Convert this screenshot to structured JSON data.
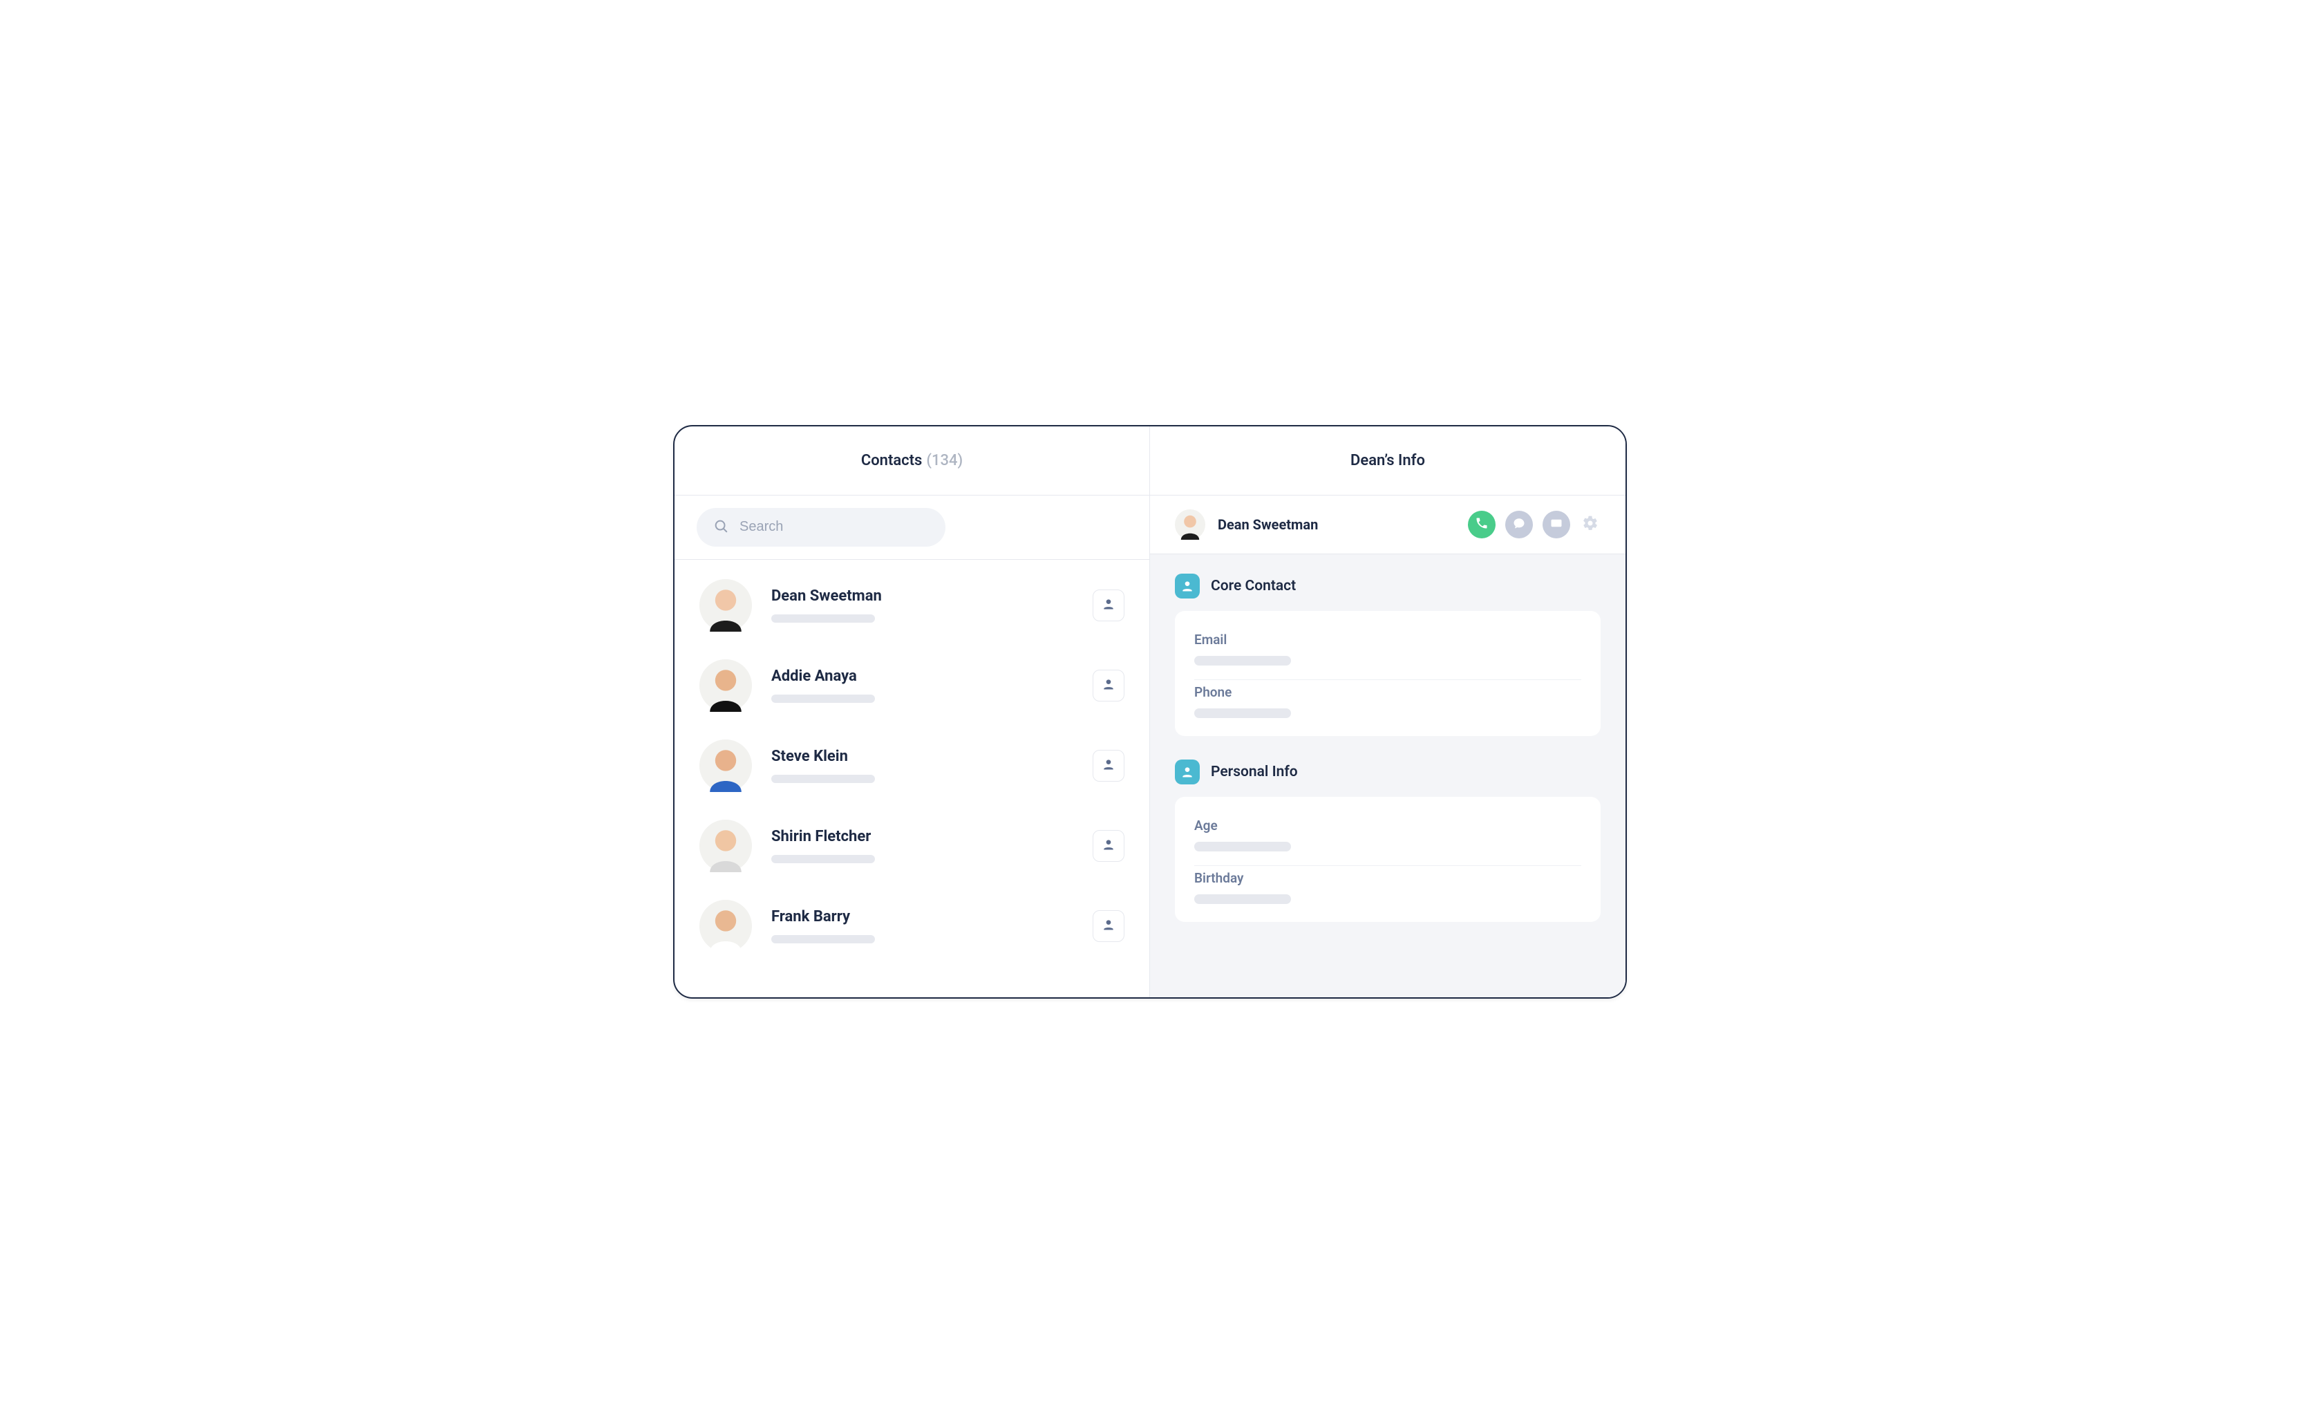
{
  "left": {
    "title": "Contacts",
    "count_display": "(134)",
    "search_placeholder": "Search"
  },
  "contacts": [
    {
      "name": "Dean Sweetman",
      "avatar": {
        "bg": "#f2f2ef",
        "skin": "#f1c7a8",
        "hair": "#c7a36b",
        "shirt": "#1c1c1c"
      }
    },
    {
      "name": "Addie Anaya",
      "avatar": {
        "bg": "#f2f2ef",
        "skin": "#e8b48c",
        "hair": "#3a2318",
        "shirt": "#111111"
      }
    },
    {
      "name": "Steve Klein",
      "avatar": {
        "bg": "#f2f2ef",
        "skin": "#e8b28c",
        "hair": "#6a4a32",
        "shirt": "#2d66c4"
      }
    },
    {
      "name": "Shirin Fletcher",
      "avatar": {
        "bg": "#f2f2ef",
        "skin": "#f0c6a3",
        "hair": "#8a5a32",
        "shirt": "#d9d9d9"
      }
    },
    {
      "name": "Frank Barry",
      "avatar": {
        "bg": "#f2f2ef",
        "skin": "#e9b892",
        "hair": "#4a3422",
        "shirt": "#ffffff"
      }
    }
  ],
  "right": {
    "title": "Dean’s Info",
    "contact_name": "Dean Sweetman",
    "avatar": {
      "bg": "#f2f2ef",
      "skin": "#f1c7a8",
      "hair": "#c7a36b",
      "shirt": "#1c1c1c"
    },
    "sections": [
      {
        "title": "Core Contact",
        "fields": [
          {
            "label": "Email"
          },
          {
            "label": "Phone"
          }
        ]
      },
      {
        "title": "Personal Info",
        "fields": [
          {
            "label": "Age"
          },
          {
            "label": "Birthday"
          }
        ]
      }
    ]
  },
  "colors": {
    "accent_green": "#49cc8a",
    "icon_grey": "#c5cbdb",
    "section_icon": "#4bb9d1"
  }
}
